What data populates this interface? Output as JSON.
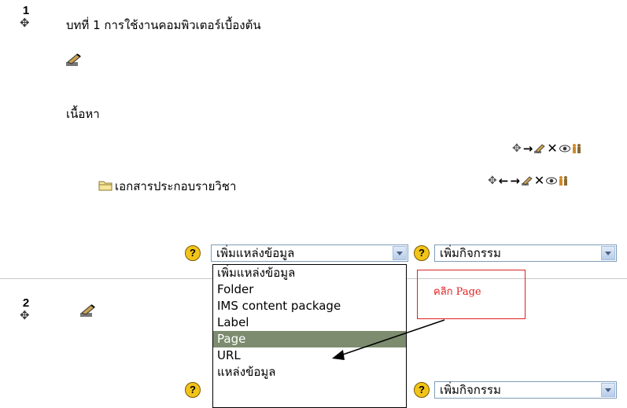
{
  "section1": {
    "number": "1",
    "title": "บทที่ 1 การใช้งานคอมพิวเตอร์เบื้องต้น",
    "content_label": "เนื้อหา",
    "resource_name": "เอกสารประกอบรายวิชา"
  },
  "section2": {
    "number": "2"
  },
  "icons": {
    "move": "✥",
    "left": "←",
    "right": "→",
    "delete": "✕"
  },
  "controls": {
    "help_mark": "?",
    "add_resource_label": "เพิ่มแหล่งข้อมูล",
    "add_activity_label": "เพิ่มกิจกรรม"
  },
  "dropdown": {
    "items": [
      "เพิ่มแหล่งข้อมูล",
      "Folder",
      "IMS content package",
      "Label",
      "Page",
      "URL",
      "แหล่งข้อมูล"
    ],
    "selected_index": 4
  },
  "callout": {
    "text": "คลิก Page",
    "color": "#e02020"
  },
  "colors": {
    "selected_bg": "#7d8c6f",
    "select_border": "#7f9db9",
    "help_yellow": "#f2c419"
  }
}
